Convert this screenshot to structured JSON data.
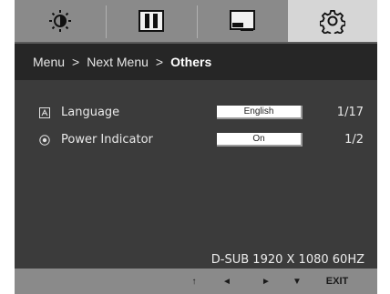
{
  "tabs": [
    {
      "icon": "brightness-icon"
    },
    {
      "icon": "picture-icon"
    },
    {
      "icon": "color-icon"
    },
    {
      "icon": "settings-gear-icon",
      "selected": true
    }
  ],
  "breadcrumb": {
    "first": "Menu",
    "sep1": ">",
    "second": "Next Menu",
    "sep2": ">",
    "current": "Others"
  },
  "settings": [
    {
      "label": "Language",
      "value": "English",
      "count": "1/17",
      "icon": "language-icon"
    },
    {
      "label": "Power Indicator",
      "value": "On",
      "count": "1/2",
      "icon": "power-indicator-icon"
    }
  ],
  "status": "D-SUB 1920 X 1080 60HZ",
  "bottom_bar": {
    "up": "↑",
    "left": "◄",
    "right": "►",
    "down": "▼",
    "exit": "EXIT"
  },
  "colors": {
    "panel": "#3b3b3b",
    "header": "#262626",
    "bar": "#8a8a8a",
    "selected_tab": "#d6d6d6"
  }
}
